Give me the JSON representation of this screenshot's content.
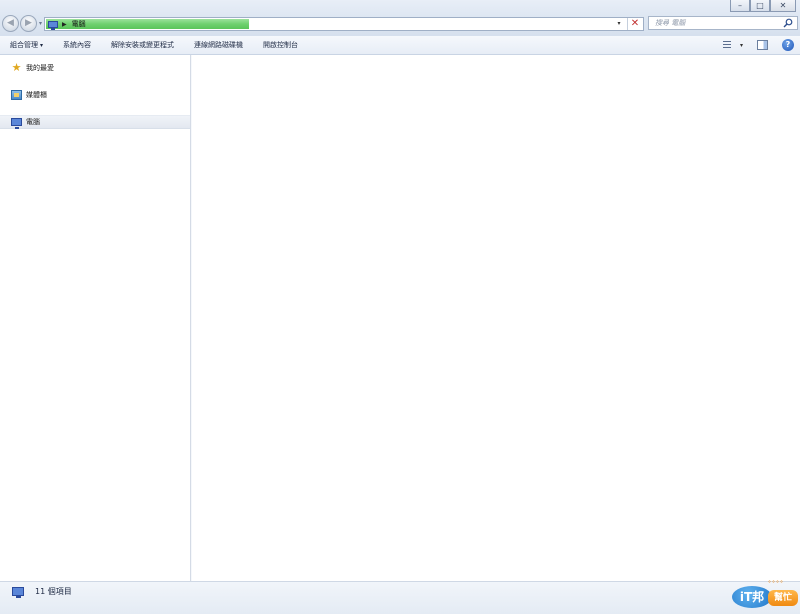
{
  "window": {
    "title": "",
    "controls": {
      "minimize": "–",
      "maximize": "□",
      "close": "✕"
    }
  },
  "nav": {
    "back": "◀",
    "forward": "▶",
    "recent": "▾"
  },
  "address": {
    "location": "電腦",
    "separator": "▶",
    "dropdown": "▾",
    "stop": "✕",
    "progress": 0.34
  },
  "search": {
    "placeholder": "搜尋 電腦"
  },
  "toolbar": {
    "items": [
      {
        "label": "組合管理",
        "has_menu": true,
        "caret": "▾"
      },
      {
        "label": "系統內容"
      },
      {
        "label": "解除安裝或變更程式"
      },
      {
        "label": "連線網路磁碟機"
      },
      {
        "label": "開啟控制台"
      }
    ],
    "views_caret": "▾",
    "help": "?"
  },
  "sidebar": {
    "items": [
      {
        "label": "我的最愛",
        "icon": "star-icon"
      },
      {
        "label": "媒體櫃",
        "icon": "library-icon"
      },
      {
        "label": "電腦",
        "icon": "computer-icon",
        "selected": true
      }
    ]
  },
  "status": {
    "item_count": "11 個項目"
  },
  "watermark": {
    "bubble": "iT邦",
    "tag": "幫忙",
    "dots": "°°°°"
  },
  "colors": {
    "progress": "#6fd06f",
    "stop": "#c23030",
    "help": "#1f56b8",
    "star": "#e0a820"
  }
}
